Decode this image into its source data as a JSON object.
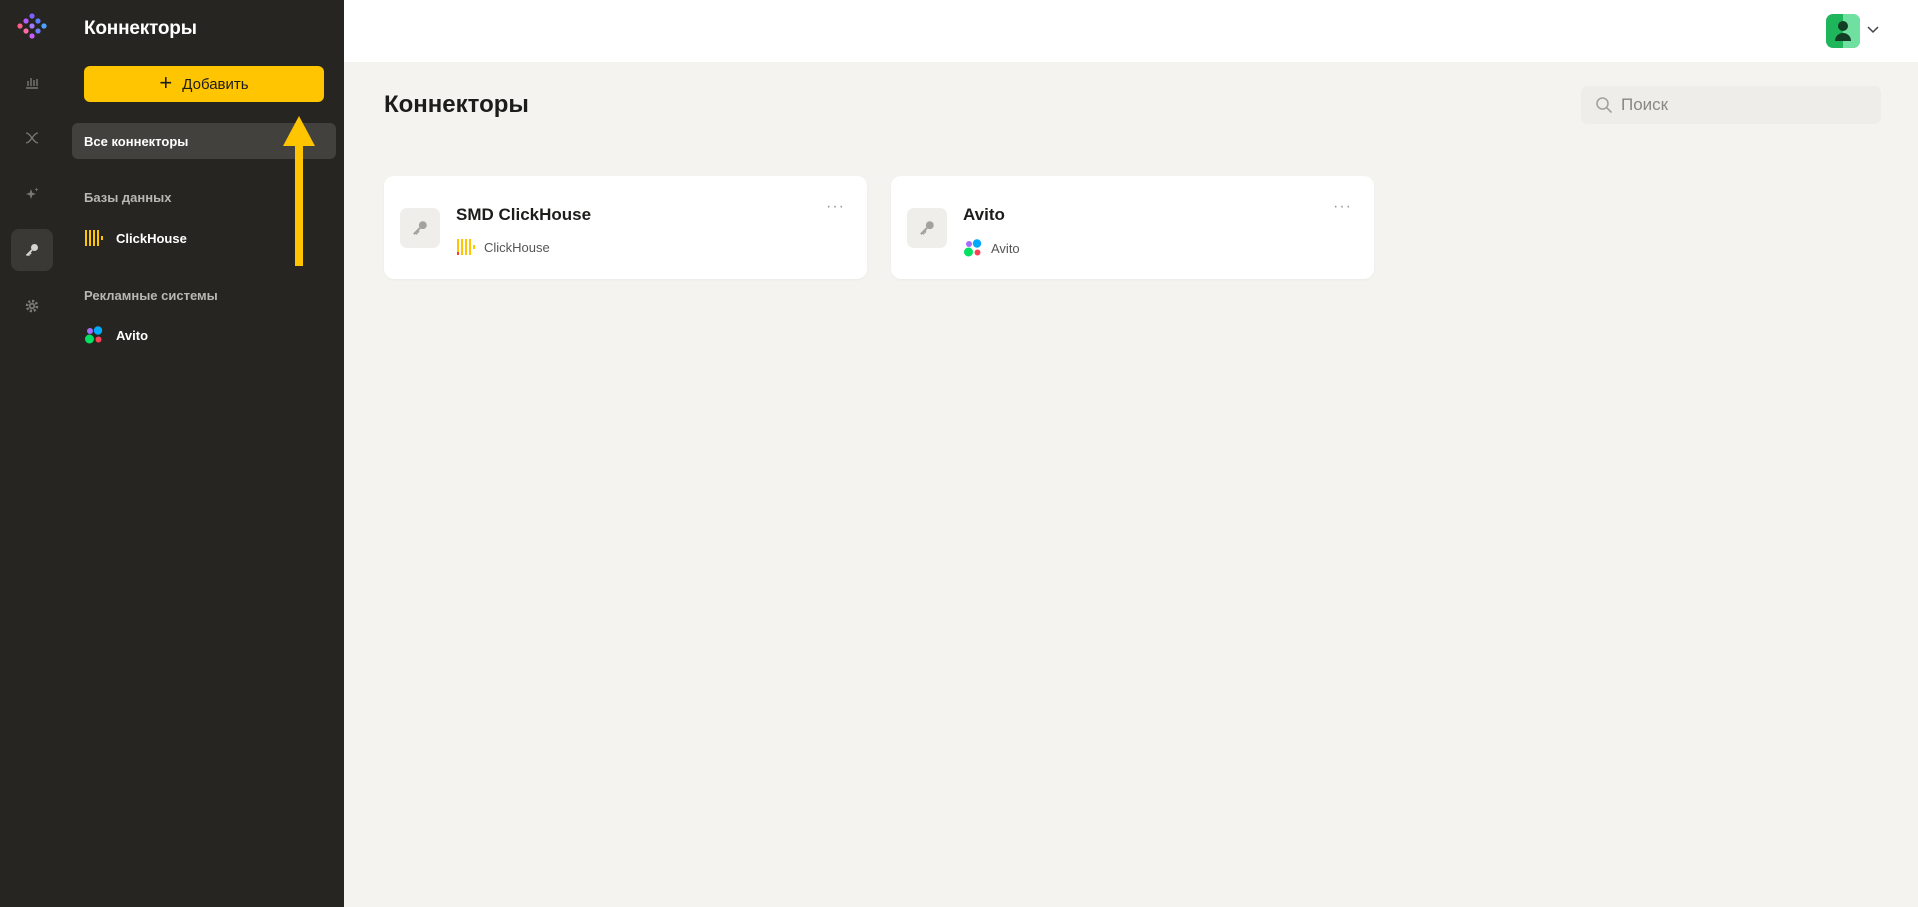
{
  "sidebar": {
    "title": "Коннекторы",
    "add_label": "Добавить",
    "all_label": "Все коннекторы",
    "sections": [
      {
        "title": "Базы данных",
        "items": [
          {
            "label": "ClickHouse",
            "icon": "clickhouse-icon"
          }
        ]
      },
      {
        "title": "Рекламные системы",
        "items": [
          {
            "label": "Avito",
            "icon": "avito-icon"
          }
        ]
      }
    ]
  },
  "rail": {
    "items": [
      "analytics-icon",
      "transform-icon",
      "ai-sparkle-icon",
      "connectors-key-icon",
      "settings-gear-icon"
    ],
    "active": "connectors-key-icon"
  },
  "main": {
    "title": "Коннекторы",
    "search_placeholder": "Поиск",
    "cards": [
      {
        "name": "SMD ClickHouse",
        "type": "ClickHouse",
        "icon": "clickhouse-icon"
      },
      {
        "name": "Avito",
        "type": "Avito",
        "icon": "avito-icon"
      }
    ],
    "more_label": "···"
  },
  "colors": {
    "accent": "#ffc500",
    "sidebar_bg": "#262521",
    "page_bg": "#f4f3f0",
    "avatar": "#1fb55a"
  }
}
